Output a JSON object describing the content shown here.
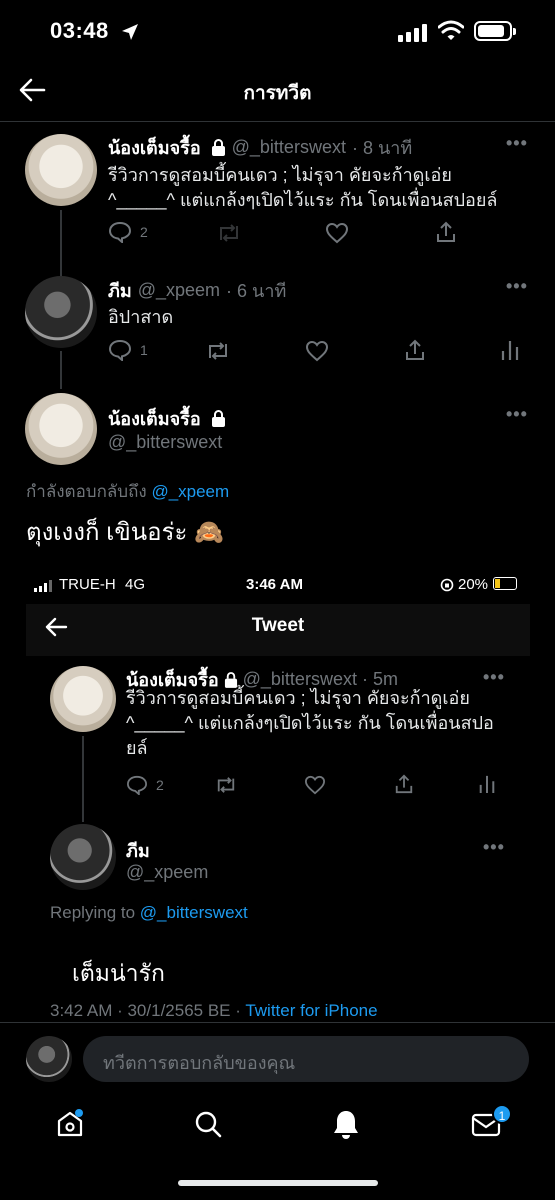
{
  "status_bar": {
    "time": "03:48"
  },
  "header": {
    "title": "การทวีต"
  },
  "tweets": [
    {
      "name": "น้องเต็มจรื้อ",
      "handle": "@_bitterswext",
      "time": "· 8 นาที",
      "line1": "รีวิวการดูสอมบี้คนเดว ; ไม่รุจา คัยจะก้าดูเอ่ย",
      "line2": "^_____^ แต่แกล้งๆเปิดไว้แระ กัน โดนเพื่อนสปอยล์",
      "reply_count": "2"
    },
    {
      "name": "ภีม",
      "handle": "@_xpeem",
      "time": "· 6 นาที",
      "text": "อิปาสาด",
      "reply_count": "1"
    }
  ],
  "main_tweet": {
    "name": "น้องเต็มจรื้อ",
    "handle": "@_bitterswext",
    "replying_prefix": "กำลังตอบกลับถึง",
    "replying_to": "@_xpeem",
    "text": "ตุงเงงก็ เขินอร่ะ",
    "emoji": "🙈"
  },
  "embedded": {
    "carrier": "TRUE-H",
    "network": "4G",
    "time": "3:46 AM",
    "battery": "20%",
    "title": "Tweet",
    "tweet": {
      "name": "น้องเต็มจรื้อ",
      "handle": "@_bitterswext",
      "time": "· 5m",
      "line1": "รีวิวการดูสอมบี้คนเดว ; ไม่รุจา คัยจะก้าดูเอ่ย",
      "line2": "^_____^ แต่แกล้งๆเปิดไว้แระ กัน โดนเพื่อนสปอ",
      "line3": "ยล์",
      "reply_count": "2"
    },
    "reply": {
      "name": "ภีม",
      "handle": "@_xpeem",
      "replying_prefix": "Replying to",
      "replying_to": "@_bitterswext",
      "text": "เต็มน่ารัก",
      "timestamp": "3:42 AM · 30/1/2565 BE · ",
      "source": "Twitter for iPhone"
    }
  },
  "reply_box": {
    "placeholder": "ทวีตการตอบกลับของคุณ"
  },
  "bottom_nav": {
    "messages_badge": "1"
  },
  "colors": {
    "accent": "#1d9bf0",
    "muted": "#71767b",
    "background": "#000000"
  }
}
